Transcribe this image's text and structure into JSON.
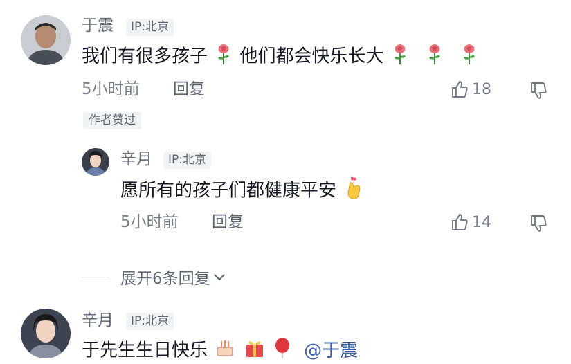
{
  "comments": [
    {
      "author": "于震",
      "ip": "IP:北京",
      "text_parts": [
        "我们有很多孩子",
        "他们都会快乐长大"
      ],
      "time": "5小时前",
      "reply_label": "回复",
      "likes": "18",
      "author_liked_tag": "作者赞过",
      "icons": [
        "rose-icon"
      ]
    },
    {
      "author": "辛月",
      "ip": "IP:北京",
      "text": "愿所有的孩子们都健康平安",
      "time": "5小时前",
      "reply_label": "回复",
      "likes": "14",
      "icons": [
        "finger-heart-icon"
      ]
    },
    {
      "author": "辛月",
      "ip": "IP:北京",
      "text_parts": [
        "于先生生日快乐",
        "@于震"
      ],
      "icons": [
        "cake-icon",
        "gift-icon",
        "balloon-icon"
      ]
    }
  ],
  "expand_replies": "展开6条回复",
  "colors": {
    "text": "#161823",
    "muted": "#7a7e86",
    "tag_bg": "#f2f3f5",
    "rose": "#e8707a"
  }
}
